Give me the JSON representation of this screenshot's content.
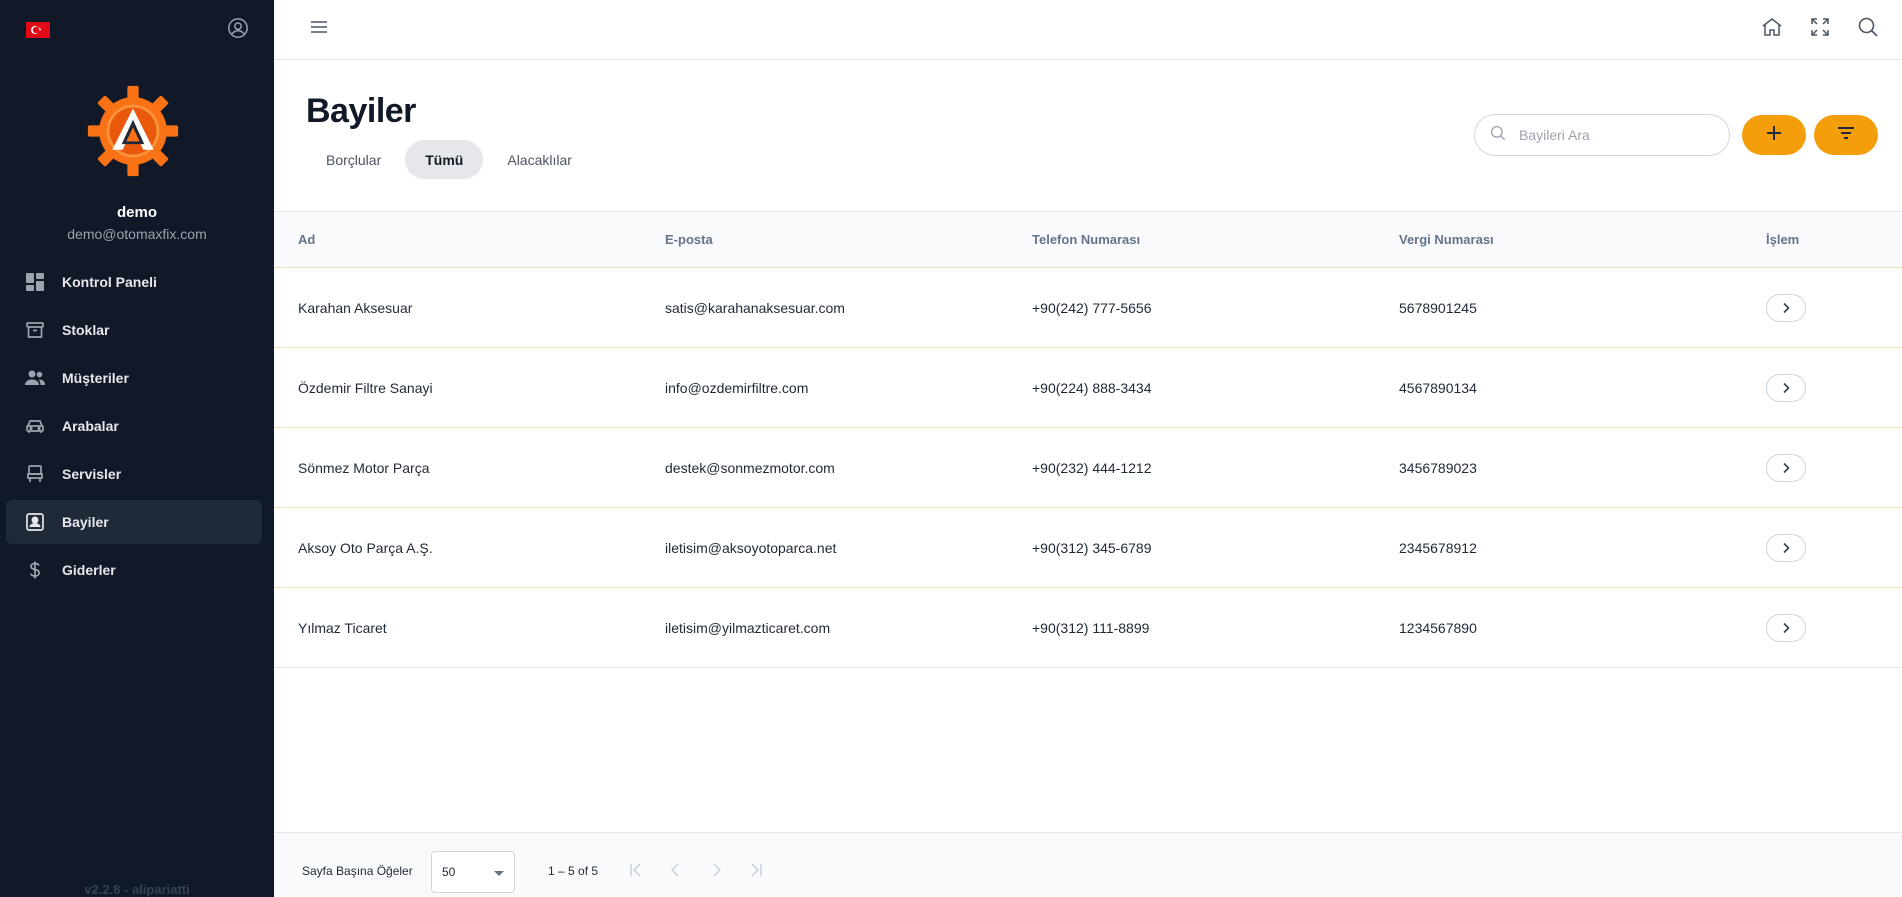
{
  "sidebar": {
    "user_name": "demo",
    "user_email": "demo@otomaxfix.com",
    "items": [
      {
        "label": "Kontrol Paneli",
        "icon": "dashboard-icon"
      },
      {
        "label": "Stoklar",
        "icon": "archive-icon"
      },
      {
        "label": "Müşteriler",
        "icon": "people-icon"
      },
      {
        "label": "Arabalar",
        "icon": "car-icon"
      },
      {
        "label": "Servisler",
        "icon": "service-seat-icon"
      },
      {
        "label": "Bayiler",
        "icon": "contact-card-icon",
        "active": true
      },
      {
        "label": "Giderler",
        "icon": "dollar-icon"
      }
    ],
    "version": "v2.2.8 - alipariatti"
  },
  "topbar": {
    "icons": [
      "menu-icon",
      "home-icon",
      "fullscreen-icon",
      "search-icon"
    ]
  },
  "page": {
    "title": "Bayiler",
    "tabs": [
      {
        "label": "Borçlular"
      },
      {
        "label": "Tümü",
        "active": true
      },
      {
        "label": "Alacaklılar"
      }
    ],
    "search_placeholder": "Bayileri Ara",
    "accent_color": "#f59e0b"
  },
  "table": {
    "headers": [
      "Ad",
      "E-posta",
      "Telefon Numarası",
      "Vergi Numarası",
      "İşlem"
    ],
    "rows": [
      {
        "name": "Karahan Aksesuar",
        "email": "satis@karahanaksesuar.com",
        "phone": "+90(242) 777-5656",
        "tax": "5678901245"
      },
      {
        "name": "Özdemir Filtre Sanayi",
        "email": "info@ozdemirfiltre.com",
        "phone": "+90(224) 888-3434",
        "tax": "4567890134"
      },
      {
        "name": "Sönmez Motor Parça",
        "email": "destek@sonmezmotor.com",
        "phone": "+90(232) 444-1212",
        "tax": "3456789023"
      },
      {
        "name": "Aksoy Oto Parça A.Ş.",
        "email": "iletisim@aksoyotoparca.net",
        "phone": "+90(312) 345-6789",
        "tax": "2345678912"
      },
      {
        "name": "Yılmaz Ticaret",
        "email": "iletisim@yilmazticaret.com",
        "phone": "+90(312) 111-8899",
        "tax": "1234567890"
      }
    ]
  },
  "footer": {
    "per_page_label": "Sayfa Başına Öğeler",
    "per_page_value": "50",
    "range_label": "1 – 5 of 5"
  }
}
